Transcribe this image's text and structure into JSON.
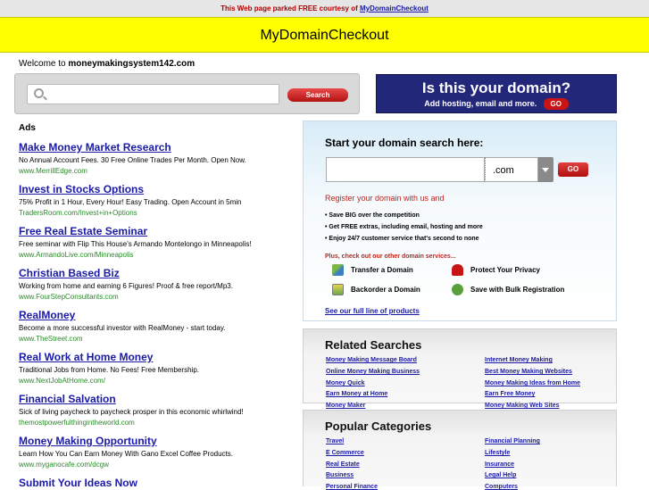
{
  "topbar": {
    "text": "This Web page parked FREE courtesy of",
    "link": "MyDomainCheckout"
  },
  "brand": {
    "title": "MyDomainCheckout"
  },
  "welcome": {
    "prefix": "Welcome to",
    "domain": "moneymakingsystem142.com"
  },
  "search": {
    "placeholder": "",
    "button": "Search"
  },
  "domain_ad": {
    "question": "Is this your domain?",
    "sub": "Add hosting, email and more.",
    "go": "GO"
  },
  "ads": {
    "heading": "Ads",
    "items": [
      {
        "title": "Make Money Market Research",
        "desc": "No Annual Account Fees. 30 Free Online Trades Per Month. Open Now.",
        "url": "www.MerrillEdge.com"
      },
      {
        "title": "Invest in Stocks Options",
        "desc": "75% Profit in 1 Hour, Every Hour! Easy Trading. Open Account in 5min",
        "url": "TradersRoom.com/Invest+in+Options"
      },
      {
        "title": "Free Real Estate Seminar",
        "desc": "Free seminar with Flip This House's Armando Montelongo in Minneapolis!",
        "url": "www.ArmandoLive.com/Minneapolis"
      },
      {
        "title": "Christian Based Biz",
        "desc": "Working from home and earning 6 Figures! Proof & free report/Mp3.",
        "url": "www.FourStepConsultants.com"
      },
      {
        "title": "RealMoney",
        "desc": "Become a more successful investor with RealMoney - start today.",
        "url": "www.TheStreet.com"
      },
      {
        "title": "Real Work at Home Money",
        "desc": "Traditional Jobs from Home. No Fees! Free Membership.",
        "url": "www.NextJobAtHome.com/"
      },
      {
        "title": "Financial Salvation",
        "desc": "Sick of living paycheck to paycheck prosper in this economic whirlwind!",
        "url": "themostpowerfulthingintheworld.com"
      },
      {
        "title": "Money Making Opportunity",
        "desc": "Learn How You Can Earn Money With Gano Excel Coffee Products.",
        "url": "www.myganocafe.com/dcgw"
      },
      {
        "title": "Submit Your Ideas Now",
        "desc": "",
        "url": ""
      }
    ]
  },
  "domain_search": {
    "heading": "Start your domain search here:",
    "tld": ".com",
    "go": "GO",
    "register": "Register your domain with us and",
    "bullets": [
      "• Save BIG over the competition",
      "• Get FREE extras, including email, hosting and more",
      "• Enjoy 24/7 customer service that's second to none"
    ],
    "plus": "Plus, check out our other domain services...",
    "services": {
      "transfer": "Transfer a Domain",
      "privacy": "Protect Your Privacy",
      "backorder": "Backorder a Domain",
      "bulk": "Save with Bulk Registration"
    },
    "more": "See our full line of products"
  },
  "related": {
    "heading": "Related Searches",
    "left": [
      "Money Making Message Board",
      "Online Money Making Business",
      "Money Quick",
      "Earn Money at Home",
      "Money Maker"
    ],
    "right": [
      "Internet Money Making",
      "Best Money Making Websites",
      "Money Making Ideas from Home",
      "Earn Free Money",
      "Money Making Web Sites"
    ]
  },
  "popular": {
    "heading": "Popular Categories",
    "left": [
      "Travel",
      "E Commerce",
      "Real Estate",
      "Business",
      "Personal Finance"
    ],
    "right": [
      "Financial Planning",
      "Lifestyle",
      "Insurance",
      "Legal Help",
      "Computers"
    ]
  }
}
